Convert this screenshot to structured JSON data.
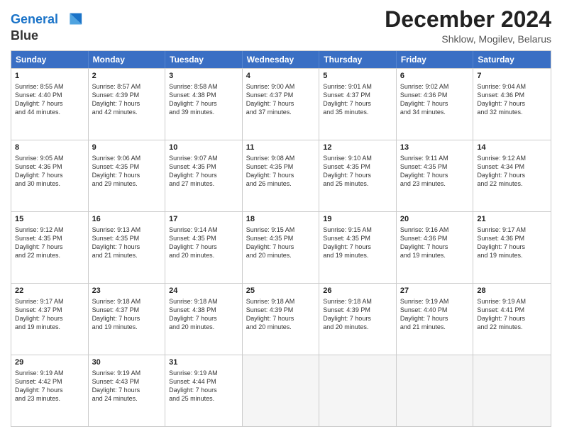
{
  "header": {
    "logo_line1": "General",
    "logo_line2": "Blue",
    "main_title": "December 2024",
    "subtitle": "Shklow, Mogilev, Belarus"
  },
  "calendar": {
    "days_of_week": [
      "Sunday",
      "Monday",
      "Tuesday",
      "Wednesday",
      "Thursday",
      "Friday",
      "Saturday"
    ],
    "weeks": [
      [
        {
          "day": "1",
          "lines": [
            "Sunrise: 8:55 AM",
            "Sunset: 4:40 PM",
            "Daylight: 7 hours",
            "and 44 minutes."
          ]
        },
        {
          "day": "2",
          "lines": [
            "Sunrise: 8:57 AM",
            "Sunset: 4:39 PM",
            "Daylight: 7 hours",
            "and 42 minutes."
          ]
        },
        {
          "day": "3",
          "lines": [
            "Sunrise: 8:58 AM",
            "Sunset: 4:38 PM",
            "Daylight: 7 hours",
            "and 39 minutes."
          ]
        },
        {
          "day": "4",
          "lines": [
            "Sunrise: 9:00 AM",
            "Sunset: 4:37 PM",
            "Daylight: 7 hours",
            "and 37 minutes."
          ]
        },
        {
          "day": "5",
          "lines": [
            "Sunrise: 9:01 AM",
            "Sunset: 4:37 PM",
            "Daylight: 7 hours",
            "and 35 minutes."
          ]
        },
        {
          "day": "6",
          "lines": [
            "Sunrise: 9:02 AM",
            "Sunset: 4:36 PM",
            "Daylight: 7 hours",
            "and 34 minutes."
          ]
        },
        {
          "day": "7",
          "lines": [
            "Sunrise: 9:04 AM",
            "Sunset: 4:36 PM",
            "Daylight: 7 hours",
            "and 32 minutes."
          ]
        }
      ],
      [
        {
          "day": "8",
          "lines": [
            "Sunrise: 9:05 AM",
            "Sunset: 4:36 PM",
            "Daylight: 7 hours",
            "and 30 minutes."
          ]
        },
        {
          "day": "9",
          "lines": [
            "Sunrise: 9:06 AM",
            "Sunset: 4:35 PM",
            "Daylight: 7 hours",
            "and 29 minutes."
          ]
        },
        {
          "day": "10",
          "lines": [
            "Sunrise: 9:07 AM",
            "Sunset: 4:35 PM",
            "Daylight: 7 hours",
            "and 27 minutes."
          ]
        },
        {
          "day": "11",
          "lines": [
            "Sunrise: 9:08 AM",
            "Sunset: 4:35 PM",
            "Daylight: 7 hours",
            "and 26 minutes."
          ]
        },
        {
          "day": "12",
          "lines": [
            "Sunrise: 9:10 AM",
            "Sunset: 4:35 PM",
            "Daylight: 7 hours",
            "and 25 minutes."
          ]
        },
        {
          "day": "13",
          "lines": [
            "Sunrise: 9:11 AM",
            "Sunset: 4:35 PM",
            "Daylight: 7 hours",
            "and 23 minutes."
          ]
        },
        {
          "day": "14",
          "lines": [
            "Sunrise: 9:12 AM",
            "Sunset: 4:34 PM",
            "Daylight: 7 hours",
            "and 22 minutes."
          ]
        }
      ],
      [
        {
          "day": "15",
          "lines": [
            "Sunrise: 9:12 AM",
            "Sunset: 4:35 PM",
            "Daylight: 7 hours",
            "and 22 minutes."
          ]
        },
        {
          "day": "16",
          "lines": [
            "Sunrise: 9:13 AM",
            "Sunset: 4:35 PM",
            "Daylight: 7 hours",
            "and 21 minutes."
          ]
        },
        {
          "day": "17",
          "lines": [
            "Sunrise: 9:14 AM",
            "Sunset: 4:35 PM",
            "Daylight: 7 hours",
            "and 20 minutes."
          ]
        },
        {
          "day": "18",
          "lines": [
            "Sunrise: 9:15 AM",
            "Sunset: 4:35 PM",
            "Daylight: 7 hours",
            "and 20 minutes."
          ]
        },
        {
          "day": "19",
          "lines": [
            "Sunrise: 9:15 AM",
            "Sunset: 4:35 PM",
            "Daylight: 7 hours",
            "and 19 minutes."
          ]
        },
        {
          "day": "20",
          "lines": [
            "Sunrise: 9:16 AM",
            "Sunset: 4:36 PM",
            "Daylight: 7 hours",
            "and 19 minutes."
          ]
        },
        {
          "day": "21",
          "lines": [
            "Sunrise: 9:17 AM",
            "Sunset: 4:36 PM",
            "Daylight: 7 hours",
            "and 19 minutes."
          ]
        }
      ],
      [
        {
          "day": "22",
          "lines": [
            "Sunrise: 9:17 AM",
            "Sunset: 4:37 PM",
            "Daylight: 7 hours",
            "and 19 minutes."
          ]
        },
        {
          "day": "23",
          "lines": [
            "Sunrise: 9:18 AM",
            "Sunset: 4:37 PM",
            "Daylight: 7 hours",
            "and 19 minutes."
          ]
        },
        {
          "day": "24",
          "lines": [
            "Sunrise: 9:18 AM",
            "Sunset: 4:38 PM",
            "Daylight: 7 hours",
            "and 20 minutes."
          ]
        },
        {
          "day": "25",
          "lines": [
            "Sunrise: 9:18 AM",
            "Sunset: 4:39 PM",
            "Daylight: 7 hours",
            "and 20 minutes."
          ]
        },
        {
          "day": "26",
          "lines": [
            "Sunrise: 9:18 AM",
            "Sunset: 4:39 PM",
            "Daylight: 7 hours",
            "and 20 minutes."
          ]
        },
        {
          "day": "27",
          "lines": [
            "Sunrise: 9:19 AM",
            "Sunset: 4:40 PM",
            "Daylight: 7 hours",
            "and 21 minutes."
          ]
        },
        {
          "day": "28",
          "lines": [
            "Sunrise: 9:19 AM",
            "Sunset: 4:41 PM",
            "Daylight: 7 hours",
            "and 22 minutes."
          ]
        }
      ],
      [
        {
          "day": "29",
          "lines": [
            "Sunrise: 9:19 AM",
            "Sunset: 4:42 PM",
            "Daylight: 7 hours",
            "and 23 minutes."
          ]
        },
        {
          "day": "30",
          "lines": [
            "Sunrise: 9:19 AM",
            "Sunset: 4:43 PM",
            "Daylight: 7 hours",
            "and 24 minutes."
          ]
        },
        {
          "day": "31",
          "lines": [
            "Sunrise: 9:19 AM",
            "Sunset: 4:44 PM",
            "Daylight: 7 hours",
            "and 25 minutes."
          ]
        },
        {
          "day": "",
          "lines": []
        },
        {
          "day": "",
          "lines": []
        },
        {
          "day": "",
          "lines": []
        },
        {
          "day": "",
          "lines": []
        }
      ]
    ]
  }
}
